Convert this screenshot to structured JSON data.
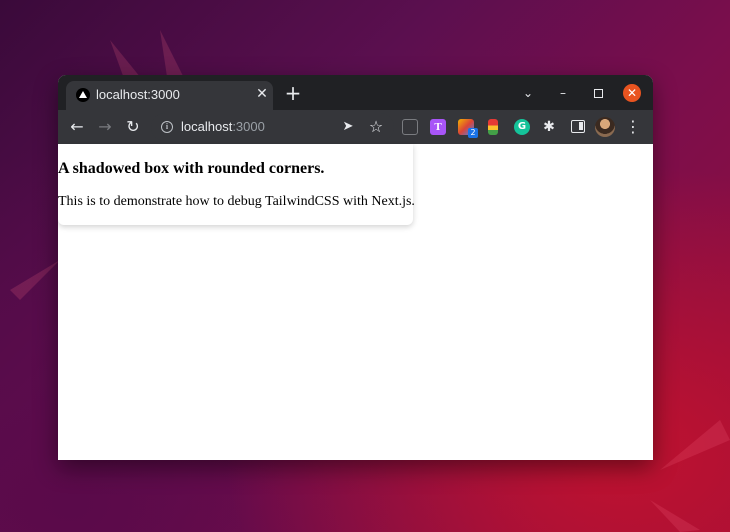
{
  "tab": {
    "title": "localhost:3000",
    "close_glyph": "✕",
    "favicon": "nextjs-triangle-icon"
  },
  "new_tab_glyph": "+",
  "window_controls": {
    "tab_search": "⌄",
    "minimize": "–",
    "close": "✕",
    "close_color": "#e95420"
  },
  "toolbar": {
    "back": "←",
    "forward": "→",
    "reload": "↻",
    "url_host": "localhost",
    "url_port": ":3000",
    "share": "➤",
    "star": "☆",
    "puzzle": "✱",
    "menu": "⋮",
    "ext_t_label": "T",
    "ext_badge": "2",
    "ext_g_label": "G"
  },
  "page": {
    "card_title": "A shadowed box with rounded corners.",
    "card_text": "This is to demonstrate how to debug TailwindCSS with Next.js."
  }
}
